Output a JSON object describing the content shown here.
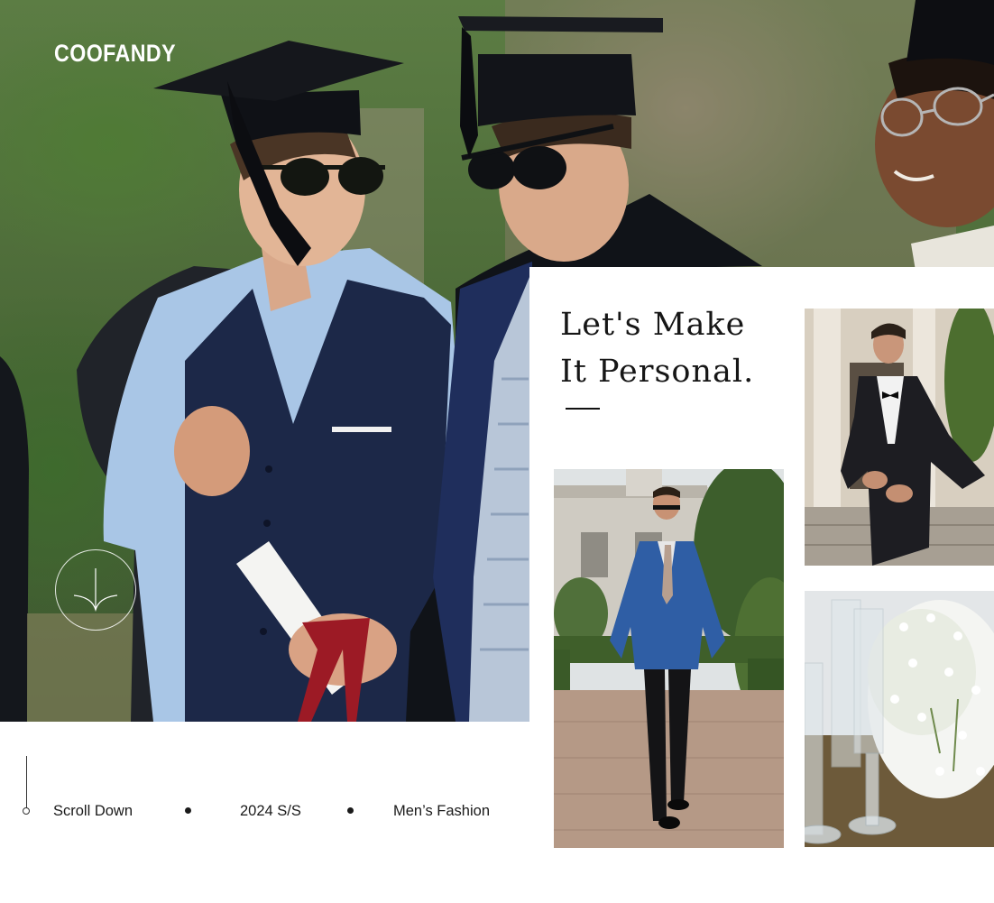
{
  "brand": {
    "name": "COOFANDY"
  },
  "headline": {
    "line1": "Let's Make",
    "line2": "It Personal."
  },
  "info_bar": {
    "scroll_label": "Scroll Down",
    "season_label": "2024 S/S",
    "category_label": "Men’s Fashion"
  },
  "images": {
    "hero": "graduates-in-caps-and-suit-vests-photo",
    "tile_1": "man-in-blue-suit-walking-photo",
    "tile_2": "man-in-black-tuxedo-photo",
    "tile_3": "babys-breath-and-glass-candle-holders-photo"
  },
  "icons": {
    "scroll": "arrow-down-icon"
  },
  "colors": {
    "background": "#ffffff",
    "text": "#1a1a1a",
    "logo": "#ffffff"
  }
}
